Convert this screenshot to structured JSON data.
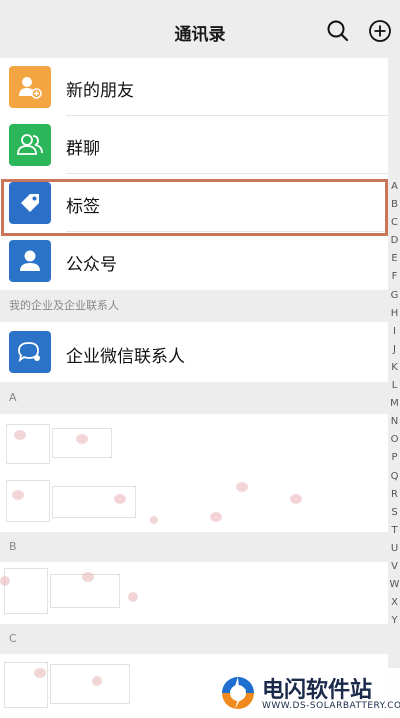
{
  "header": {
    "title": "通讯录"
  },
  "items": [
    {
      "label": "新的朋友",
      "color": "#f2a541",
      "icon": "add-friend-icon"
    },
    {
      "label": "群聊",
      "color": "#2bb659",
      "icon": "group-chat-icon"
    },
    {
      "label": "标签",
      "color": "#2b6fc9",
      "icon": "tag-icon"
    },
    {
      "label": "公众号",
      "color": "#2b72c9",
      "icon": "official-account-icon"
    }
  ],
  "enterprise": {
    "section_label": "我的企业及企业联系人",
    "item_label": "企业微信联系人",
    "color": "#2b72c9"
  },
  "sections": [
    "A",
    "B",
    "C"
  ],
  "index_letters": [
    "A",
    "B",
    "C",
    "D",
    "E",
    "F",
    "G",
    "H",
    "I",
    "J",
    "K",
    "L",
    "M",
    "N",
    "O",
    "P",
    "Q",
    "R",
    "S",
    "T",
    "U",
    "V",
    "W",
    "X",
    "Y"
  ],
  "watermark": {
    "brand": "电闪软件站",
    "sub": "WWW.DS-SOLARBATTERY.COM"
  },
  "colors": {
    "highlight": "#c8765a",
    "background": "#ededed"
  }
}
